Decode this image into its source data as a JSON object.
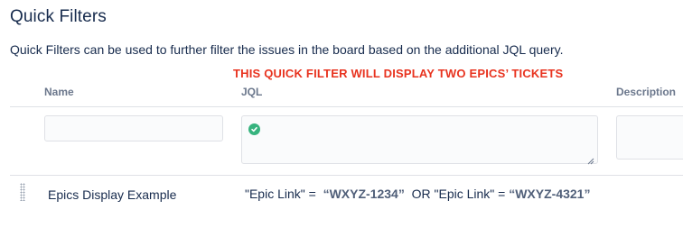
{
  "section": {
    "title": "Quick Filters",
    "description": "Quick Filters can be used to further filter the issues in the board based on the additional JQL query.",
    "annotation": "THIS QUICK FILTER WILL DISPLAY TWO EPICS’ TICKETS"
  },
  "table": {
    "columns": [
      "Name",
      "JQL",
      "Description"
    ]
  },
  "new_filter": {
    "name_value": "",
    "jql_value": "",
    "description_value": "",
    "jql_status_icon": "check-circle-icon",
    "status_color": "#36b37e"
  },
  "rows": [
    {
      "name": "Epics Display Example",
      "jql_part1": "\"Epic Link\" =  ",
      "jql_key1": "“WXYZ-1234”",
      "jql_part2": "  OR \"Epic Link\" = ",
      "jql_key2": "“WXYZ-4321”"
    }
  ]
}
